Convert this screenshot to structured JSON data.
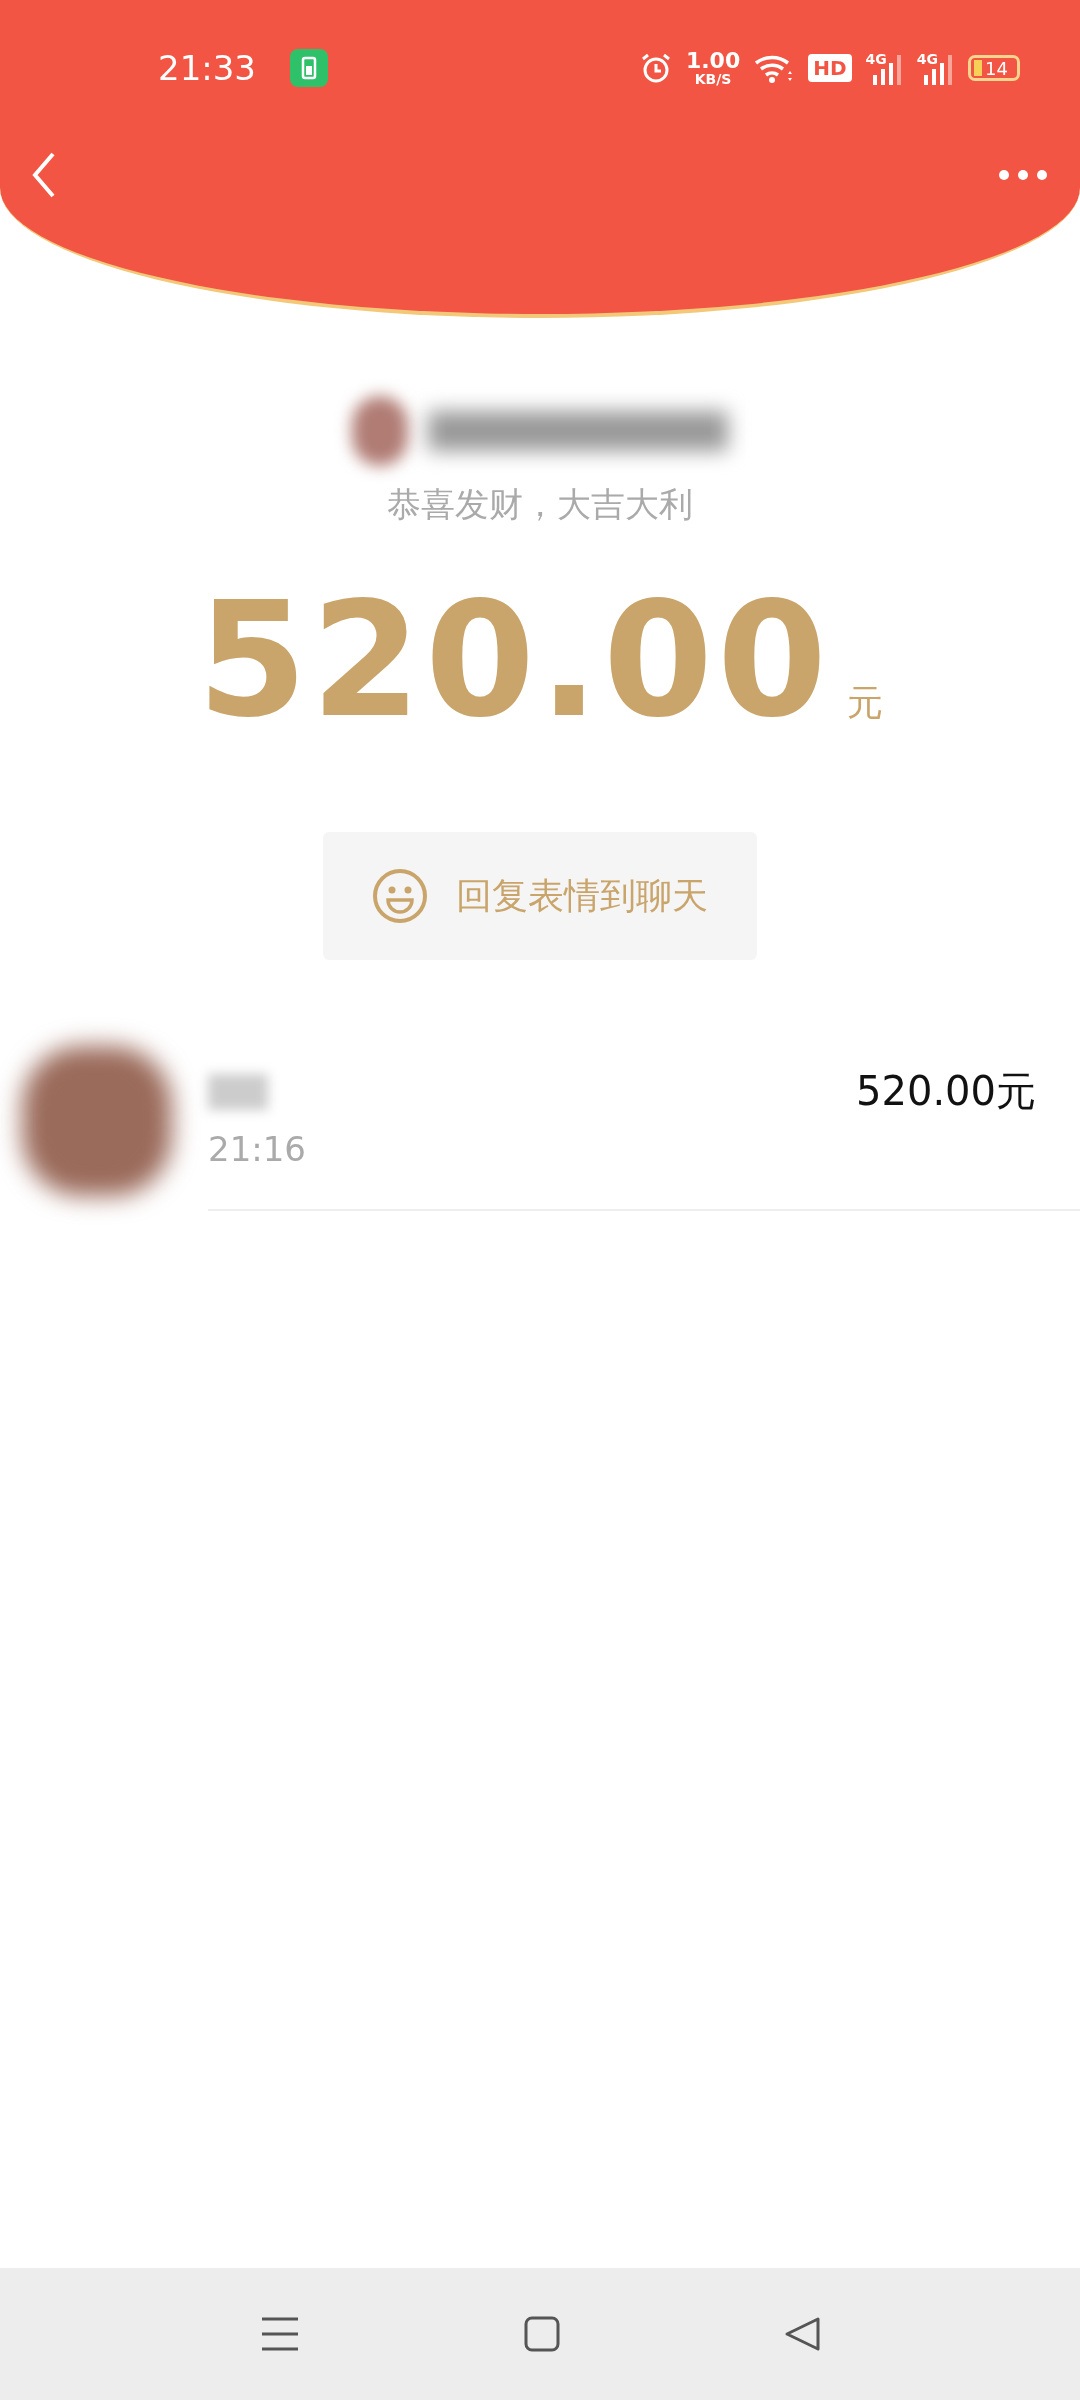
{
  "status_bar": {
    "time": "21:33",
    "speed_value": "1.00",
    "speed_unit": "KB/S",
    "hd": "HD",
    "networks": [
      "4G",
      "4G"
    ],
    "battery": "14"
  },
  "greeting": "恭喜发财，大吉大利",
  "amount": {
    "value": "520.00",
    "unit": "元"
  },
  "reply_button": {
    "label": "回复表情到聊天"
  },
  "receivers": [
    {
      "time": "21:16",
      "amount": "520.00元"
    }
  ]
}
